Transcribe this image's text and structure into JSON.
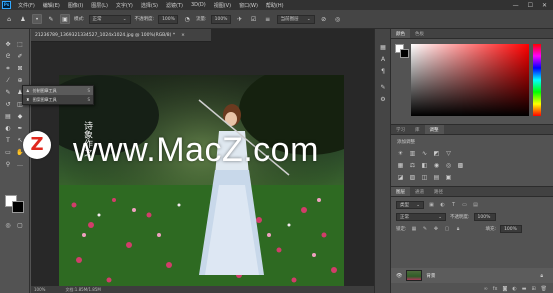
{
  "app": {
    "logo_text": "Ps"
  },
  "menubar": {
    "items": [
      "文件(F)",
      "编辑(E)",
      "图像(I)",
      "图层(L)",
      "文字(Y)",
      "选择(S)",
      "滤镜(T)",
      "3D(D)",
      "视图(V)",
      "窗口(W)",
      "帮助(H)"
    ],
    "window_controls": [
      "—",
      "☐",
      "✕"
    ]
  },
  "optionsbar": {
    "mode_value": "正常",
    "opacity_label": "不透明度:",
    "opacity_value": "100%",
    "flow_label": "流量:",
    "flow_value": "100%",
    "sample_value": "当前图层"
  },
  "document": {
    "tab_title": "21236789_1369321334527_1024x1024.jpg @ 100%(RGB/8) *",
    "tab_close": "×",
    "zoom": "100%",
    "doc_info": "文档:1.85M/1.85M"
  },
  "tool_flyout": {
    "items": [
      {
        "label": "仿制图章工具",
        "shortcut": "S"
      },
      {
        "label": "图案图章工具",
        "shortcut": "S"
      }
    ]
  },
  "overlay": {
    "watermark_text": "www.MacZ.com",
    "logo_letter": "Z",
    "photo_caption": "诗象作之"
  },
  "panels": {
    "color_tabs": [
      "颜色",
      "色板"
    ],
    "adjust_tabs": [
      "学习",
      "库",
      "调整"
    ],
    "adjust_title": "添加调整",
    "layers_tabs": [
      "图层",
      "通道",
      "路径"
    ],
    "layers_filter": "类型",
    "blend_mode": "正常",
    "opacity_label": "不透明度:",
    "opacity_value": "100%",
    "lock_label": "锁定:",
    "fill_label": "填充:",
    "fill_value": "100%",
    "layer_name": "背景"
  },
  "colors": {
    "accent": "#31a8ff",
    "logo_red": "#e0281e"
  }
}
